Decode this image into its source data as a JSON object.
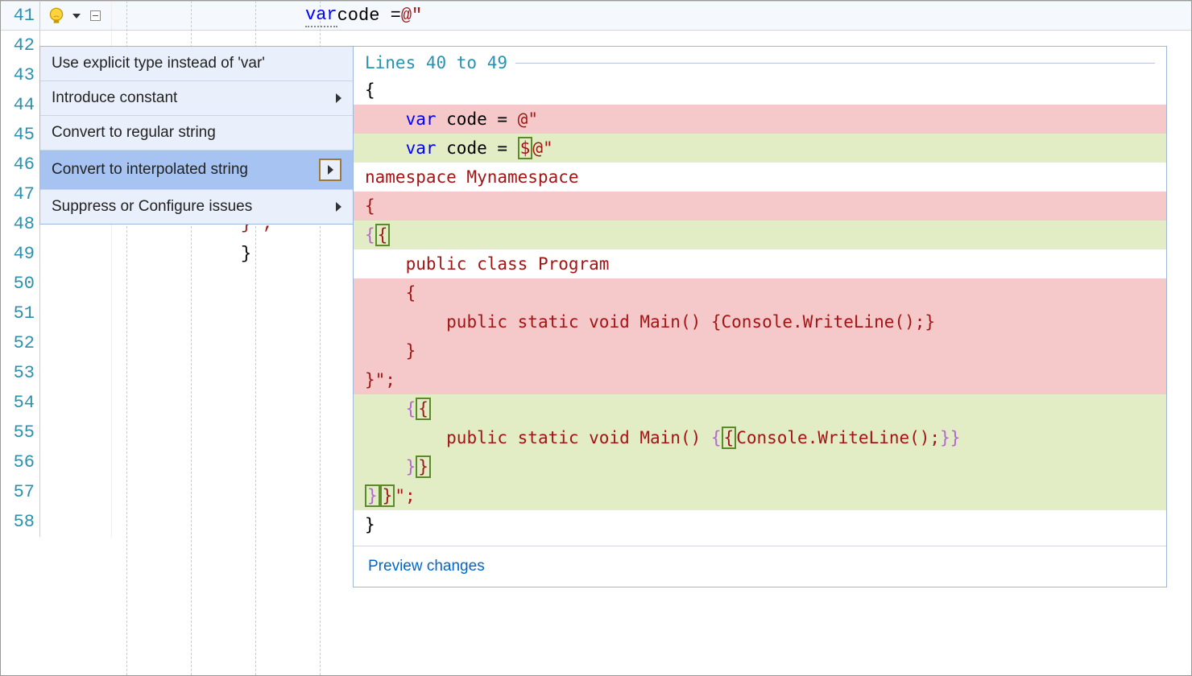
{
  "gutter": {
    "start": 41,
    "lines": [
      "41",
      "42",
      "43",
      "44",
      "45",
      "46",
      "47",
      "48",
      "49",
      "50",
      "51",
      "52",
      "53",
      "54",
      "55",
      "56",
      "57",
      "58"
    ]
  },
  "editor": {
    "line41_var": "var",
    "line41_code": " code = ",
    "line41_str": "@\"",
    "line47_brace": "}",
    "line48_close": "}\";",
    "line49_brace": "}"
  },
  "quick_actions": {
    "items": [
      {
        "label": "Use explicit type instead of 'var'",
        "has_submenu": false
      },
      {
        "label": "Introduce constant",
        "has_submenu": true
      },
      {
        "label": "Convert to regular string",
        "has_submenu": false
      },
      {
        "label": "Convert to interpolated string",
        "has_submenu": true,
        "selected": true
      },
      {
        "label": "Suppress or Configure issues",
        "has_submenu": true
      }
    ]
  },
  "preview": {
    "header": "Lines 40 to 49",
    "rows": [
      {
        "bg": "none",
        "indent": 0,
        "segments": [
          {
            "t": "{",
            "c": "black"
          }
        ]
      },
      {
        "bg": "del",
        "indent": 4,
        "segments": [
          {
            "t": "var",
            "c": "blue"
          },
          {
            "t": " code = ",
            "c": "black"
          },
          {
            "t": "@\"",
            "c": "brown"
          }
        ]
      },
      {
        "bg": "add",
        "indent": 4,
        "segments": [
          {
            "t": "var",
            "c": "blue"
          },
          {
            "t": " code = ",
            "c": "black"
          },
          {
            "t": "$",
            "c": "brown",
            "box": true
          },
          {
            "t": "@\"",
            "c": "brown"
          }
        ]
      },
      {
        "bg": "none",
        "indent": 0,
        "segments": [
          {
            "t": "namespace Mynamespace",
            "c": "brown"
          }
        ]
      },
      {
        "bg": "del",
        "indent": 0,
        "segments": [
          {
            "t": "{",
            "c": "brown"
          }
        ]
      },
      {
        "bg": "add",
        "indent": 0,
        "segments": [
          {
            "t": "{",
            "c": "purple"
          },
          {
            "t": "{",
            "c": "brown",
            "box": true
          }
        ]
      },
      {
        "bg": "none",
        "indent": 4,
        "segments": [
          {
            "t": "public class Program",
            "c": "brown"
          }
        ]
      },
      {
        "bg": "del",
        "indent": 4,
        "segments": [
          {
            "t": "{",
            "c": "brown"
          }
        ]
      },
      {
        "bg": "del",
        "indent": 8,
        "segments": [
          {
            "t": "public static void Main() {Console.WriteLine();}",
            "c": "brown"
          }
        ]
      },
      {
        "bg": "del",
        "indent": 4,
        "segments": [
          {
            "t": "}",
            "c": "brown"
          }
        ]
      },
      {
        "bg": "del",
        "indent": 0,
        "segments": [
          {
            "t": "}\";",
            "c": "brown"
          }
        ]
      },
      {
        "bg": "add",
        "indent": 4,
        "segments": [
          {
            "t": "{",
            "c": "purple"
          },
          {
            "t": "{",
            "c": "brown",
            "box": true
          }
        ]
      },
      {
        "bg": "add",
        "indent": 8,
        "segments": [
          {
            "t": "public static void Main() ",
            "c": "brown"
          },
          {
            "t": "{",
            "c": "purple"
          },
          {
            "t": "{",
            "c": "brown",
            "box": true
          },
          {
            "t": "Console.WriteLine();",
            "c": "brown"
          },
          {
            "t": "}",
            "c": "purple"
          },
          {
            "t": "}",
            "c": "purple"
          }
        ]
      },
      {
        "bg": "add",
        "indent": 4,
        "segments": [
          {
            "t": "}",
            "c": "purple"
          },
          {
            "t": "}",
            "c": "brown",
            "box": true
          }
        ]
      },
      {
        "bg": "add",
        "indent": 0,
        "segments": [
          {
            "t": "}",
            "c": "purple",
            "box": true
          },
          {
            "t": "}",
            "c": "brown",
            "box": true
          },
          {
            "t": "\";",
            "c": "brown"
          }
        ]
      },
      {
        "bg": "none",
        "indent": 0,
        "segments": [
          {
            "t": "}",
            "c": "black"
          }
        ]
      }
    ],
    "footer_link": "Preview changes"
  }
}
